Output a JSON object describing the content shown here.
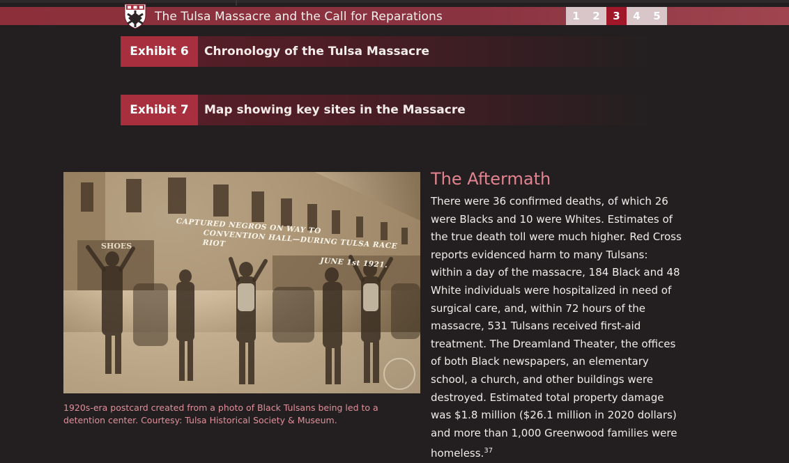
{
  "header": {
    "title": "The Tulsa Massacre and the Call for Reparations",
    "logo": "harvard-shield-icon",
    "pages": [
      "1",
      "2",
      "3",
      "4",
      "5"
    ],
    "active_page": "3",
    "accent_color": "#a0172a"
  },
  "exhibits": [
    {
      "tag": "Exhibit 6",
      "title": "Chronology of the Tulsa Massacre"
    },
    {
      "tag": "Exhibit 7",
      "title": "Map showing key sites in the Massacre"
    }
  ],
  "photo": {
    "inscription": [
      "CAPTURED NEGROS ON WAY TO",
      "CONVENTION HALL—DURING TULSA RACE RIOT",
      "JUNE 1st 1921."
    ],
    "store_sign": "SHOES",
    "caption": "1920s-era postcard created from a photo of Black Tulsans being led to a detention center. Courtesy: Tulsa Historical Society & Museum."
  },
  "article": {
    "heading": "The Aftermath",
    "body": "There were 36 confirmed deaths, of which 26 were Blacks and 10 were Whites. Estimates of the true death toll were much higher. Red Cross reports evidenced harm to many Tulsans: within a day of the massacre, 184 Black and 48 White individuals were hospitalized in need of surgical care, and, within 72 hours of the massacre, 531 Tulsans received first-aid treatment. The Dreamland Theater, the offices of both Black newspapers, an elementary school, a church, and other buildings were destroyed. Estimated total property damage was $1.8 million ($26.1 million in 2020 dollars) and more than 1,000 Greenwood families were homeless.",
    "footnote": "37"
  }
}
